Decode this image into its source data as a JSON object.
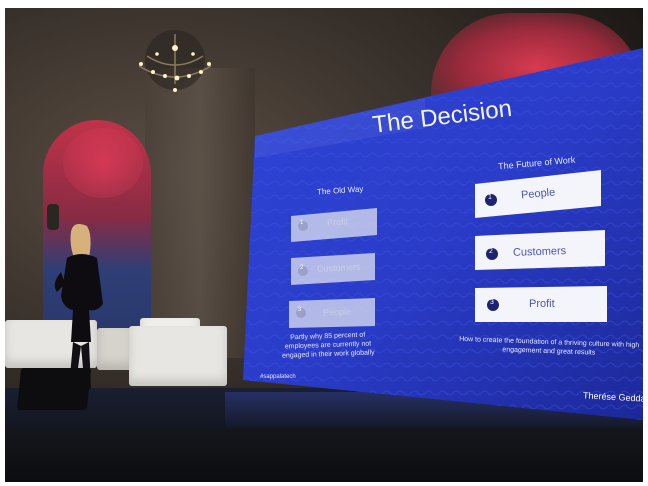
{
  "slide": {
    "title": "The Decision",
    "old_way": {
      "heading": "The Old Way",
      "items": [
        {
          "number": "1",
          "label": "Profit"
        },
        {
          "number": "2",
          "label": "Customers"
        },
        {
          "number": "3",
          "label": "People"
        }
      ],
      "caption": "Partly why 85 percent of employees are currently not engaged in their work globally"
    },
    "future_of_work": {
      "heading": "The Future of Work",
      "items": [
        {
          "number": "1",
          "label": "People"
        },
        {
          "number": "2",
          "label": "Customers"
        },
        {
          "number": "3",
          "label": "Profit"
        }
      ],
      "caption": "How to create the foundation of a thriving culture with high engagement and great results"
    },
    "hashtag": "#sappalatech",
    "speaker": "Therése Gedda"
  },
  "colors": {
    "screen_blue": "#2b3fcf",
    "screen_blue_dark": "#1a2690",
    "box_white": "#f4f5fb",
    "number_circle": "#1c2470",
    "arch_red": "#c7324a"
  }
}
